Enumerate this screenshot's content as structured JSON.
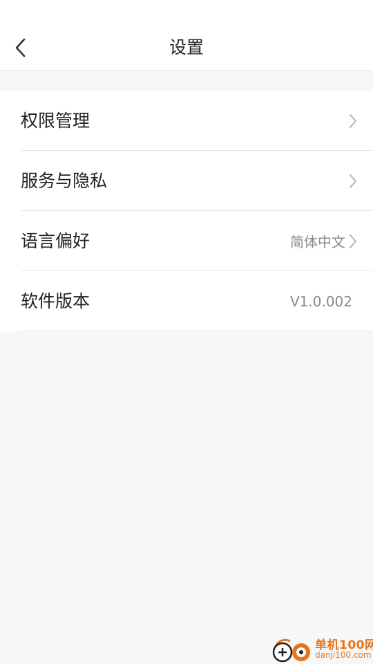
{
  "header": {
    "title": "设置",
    "back_icon": "chevron-left-icon"
  },
  "settings": [
    {
      "label": "权限管理",
      "value": "",
      "chevron": true
    },
    {
      "label": "服务与隐私",
      "value": "",
      "chevron": true
    },
    {
      "label": "语言偏好",
      "value": "简体中文",
      "chevron": true
    },
    {
      "label": "软件版本",
      "value": "V1.0.002",
      "chevron": false
    }
  ],
  "watermark": {
    "name": "单机100网",
    "url": "danji100.com"
  },
  "colors": {
    "background": "#f7f7f7",
    "surface": "#ffffff",
    "text_primary": "#222222",
    "text_secondary": "#8a8a8a",
    "chevron": "#b5b5b5",
    "watermark_accent": "#e6751e"
  }
}
